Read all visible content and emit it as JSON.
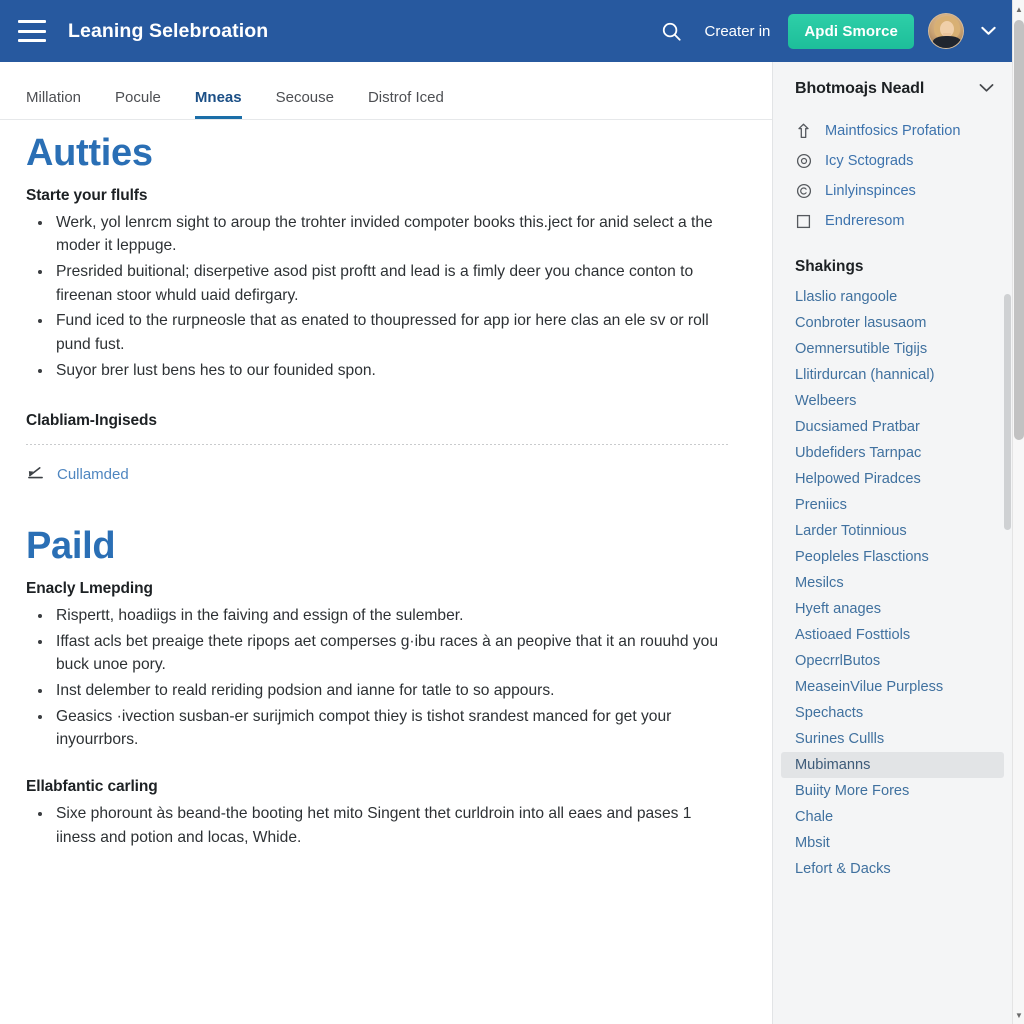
{
  "header": {
    "menu_icon": "hamburger-menu-icon",
    "title": "Leaning Selebroation",
    "search_icon": "search-icon",
    "signin_label": "Creater in",
    "cta_label": "Apdi Smorce",
    "avatar_icon": "user-avatar",
    "account_chevron_icon": "chevron-down-icon"
  },
  "tabs": [
    {
      "label": "Millation",
      "active": false
    },
    {
      "label": "Pocule",
      "active": false
    },
    {
      "label": "Mneas",
      "active": true
    },
    {
      "label": "Secouse",
      "active": false
    },
    {
      "label": "Distrof Iced",
      "active": false
    }
  ],
  "main": {
    "sections": [
      {
        "heading": "Autties",
        "subheading": "Starte your flulfs",
        "bullets": [
          "Werk, yol lenrcm sight to aroup the trohter invided compoter books this.ject for anid select a the moder it leppuge.",
          "Presrided buitional; diserpetive asod pist proftt and lead is a fimly deer you chance conton to fireenan stoor whuld uaid defirgary.",
          "Fund iced to the rurpneosle that as enated to thoupressed for app ior here clas an ele sv or roll pund fust.",
          "Suyor brer lust bens hes to our founided spon."
        ],
        "attachments_heading": "Clabliam-Ingiseds",
        "attachment": {
          "icon": "attachment-upload-icon",
          "label": "Cullamded"
        }
      },
      {
        "heading": "Paild",
        "groups": [
          {
            "subheading": "Enacly Lmepding",
            "bullets": [
              "Rispertt, hoadiigs in the faiving and essign of the sulember.",
              "Iffast acls bet preaige thete ripops aet comperses g·ibu races à an peopive that it an rouuhd you buck unoe pory.",
              "Inst delember to reald reriding podsion and ianne for tatle to so appours.",
              "Geasics ·ivection susban-er surijmich compot thiey is tishot srandest manced for get your inyourrbors."
            ]
          },
          {
            "subheading": "Ellabfantic carling",
            "bullets": [
              "Sixe phorount às beand-the booting het mito Singent thet curldroin into all eaes and pases 1 iiness and potion and locas, Whide."
            ]
          }
        ]
      }
    ]
  },
  "sidebar": {
    "title": "Bhotmoajs Neadl",
    "collapse_icon": "chevron-down-icon",
    "icon_items": [
      {
        "icon": "upload-arrow-icon",
        "label": "Maintfosics Profation"
      },
      {
        "icon": "circle-a-icon",
        "label": "Icy Sctograds"
      },
      {
        "icon": "copyright-circle-icon",
        "label": "Linlyinspinces"
      },
      {
        "icon": "square-outline-icon",
        "label": "Endreresom"
      }
    ],
    "links_heading": "Shakings",
    "links": [
      {
        "label": "Llaslio rangoole",
        "active": false
      },
      {
        "label": "Conbroter lasusaom",
        "active": false
      },
      {
        "label": "Oemnersutible Tigijs",
        "active": false
      },
      {
        "label": "Llitirdurcan (hannical)",
        "active": false
      },
      {
        "label": "Welbeers",
        "active": false
      },
      {
        "label": "Ducsiamed Pratbar",
        "active": false
      },
      {
        "label": "Ubdefiders Tarnpac",
        "active": false
      },
      {
        "label": "Helpowed Piradces",
        "active": false
      },
      {
        "label": "Preniics",
        "active": false
      },
      {
        "label": "Larder Totinnious",
        "active": false
      },
      {
        "label": "Peopleles Flasctions",
        "active": false
      },
      {
        "label": "Mesilcs",
        "active": false
      },
      {
        "label": "Hyeft anages",
        "active": false
      },
      {
        "label": "Astioaed Fosttiols",
        "active": false
      },
      {
        "label": "OpecrrlВutos",
        "active": false
      },
      {
        "label": "MeaseinVilue Purpless",
        "active": false
      },
      {
        "label": "Spechacts",
        "active": false
      },
      {
        "label": "Surines Cullls",
        "active": false
      },
      {
        "label": "Mubimanns",
        "active": true
      },
      {
        "label": "Buiity More Fores",
        "active": false
      },
      {
        "label": "Chale",
        "active": false
      },
      {
        "label": "Mbsit",
        "active": false
      },
      {
        "label": "Lefort & Dacks",
        "active": false
      }
    ]
  },
  "scrollbar": {
    "up_arrow_icon": "scroll-up-arrow-icon",
    "down_arrow_icon": "scroll-down-arrow-icon"
  },
  "colors": {
    "appbar": "#27599f",
    "cta": "#25c9a5",
    "heading_blue": "#2a6fb5",
    "link_blue": "#40719f",
    "sidebar_bg": "#f4f5f6",
    "active_tab": "#1b6ea8"
  }
}
